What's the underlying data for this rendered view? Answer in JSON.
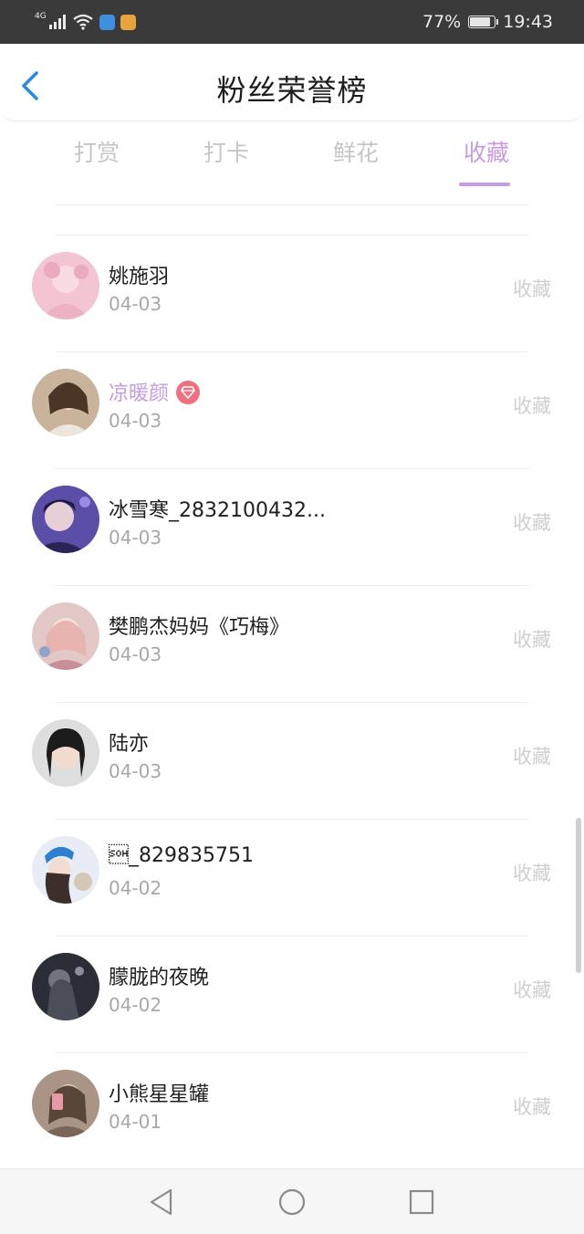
{
  "status_bar": {
    "network": "4G",
    "battery_percent": "77%",
    "battery_level": 0.77,
    "time": "19:43",
    "icons": [
      "signal-icon",
      "wifi-icon",
      "shield-app-icon",
      "orange-app-icon",
      "battery-icon"
    ]
  },
  "header": {
    "back_icon": "chevron-left-icon",
    "title": "粉丝荣誉榜"
  },
  "tabs": [
    {
      "label": "打赏",
      "active": false
    },
    {
      "label": "打卡",
      "active": false
    },
    {
      "label": "鲜花",
      "active": false
    },
    {
      "label": "收藏",
      "active": true
    }
  ],
  "colors": {
    "accent": "#c79be0",
    "vip_badge": "#f07080",
    "action_text": "#cfcfcf",
    "date_text": "#a8a8a8"
  },
  "list": [
    {
      "name": "姚施羽",
      "date": "04-03",
      "action": "收藏",
      "vip": false
    },
    {
      "name": "凉暖颜",
      "date": "04-03",
      "action": "收藏",
      "vip": true
    },
    {
      "name": "冰雪寒_2832100432...",
      "date": "04-03",
      "action": "收藏",
      "vip": false
    },
    {
      "name": "樊鹏杰妈妈《巧梅》",
      "date": "04-03",
      "action": "收藏",
      "vip": false
    },
    {
      "name": "陆亦",
      "date": "04-03",
      "action": "收藏",
      "vip": false
    },
    {
      "name": "\u0001_829835751",
      "date": "04-02",
      "action": "收藏",
      "vip": false
    },
    {
      "name": "朦胧的夜晚",
      "date": "04-02",
      "action": "收藏",
      "vip": false
    },
    {
      "name": "小熊星星罐",
      "date": "04-01",
      "action": "收藏",
      "vip": false
    }
  ],
  "nav_bar": {
    "icons": [
      "back-triangle-icon",
      "home-circle-icon",
      "recents-square-icon"
    ]
  }
}
